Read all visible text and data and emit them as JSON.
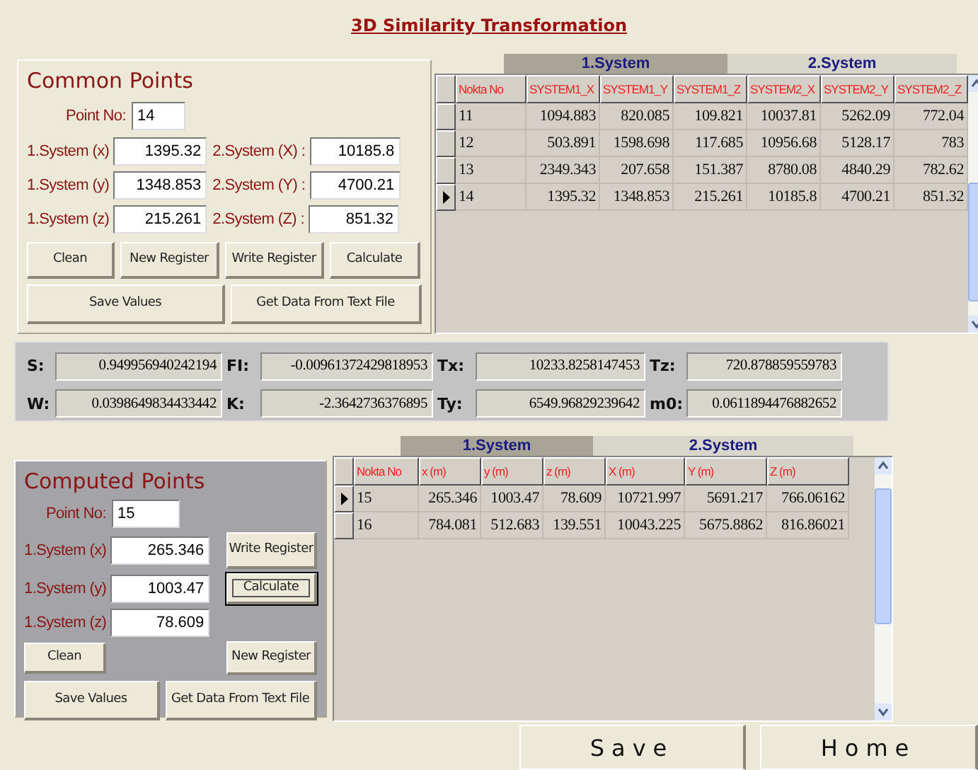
{
  "title": "3D Similarity Transformation",
  "common_points": {
    "heading": "Common Points",
    "point_no": {
      "label": "Point No:",
      "value": "14"
    },
    "fields": [
      {
        "label": "1.System (x)",
        "value": "1395.32"
      },
      {
        "label": "2.System (X) :",
        "value": "10185.8"
      },
      {
        "label": "1.System (y)",
        "value": "1348.853"
      },
      {
        "label": "2.System (Y) :",
        "value": "4700.21"
      },
      {
        "label": "1.System (z)",
        "value": "215.261"
      },
      {
        "label": "2.System (Z) :",
        "value": "851.32"
      }
    ],
    "buttons": [
      {
        "label": "Clean",
        "focused": false
      },
      {
        "label": "New Register",
        "focused": false
      },
      {
        "label": "Write Register",
        "focused": false
      },
      {
        "label": "Calculate",
        "focused": false
      },
      {
        "label": "Save Values",
        "focused": false
      },
      {
        "label": "Get Data From Text File",
        "focused": false
      }
    ]
  },
  "common_grid": {
    "groups": [
      {
        "label": "1.System",
        "selected": true
      },
      {
        "label": "2.System",
        "selected": false
      }
    ],
    "columns": [
      "Nokta No",
      "SYSTEM1_X",
      "SYSTEM1_Y",
      "SYSTEM1_Z",
      "SYSTEM2_X",
      "SYSTEM2_Y",
      "SYSTEM2_Z"
    ],
    "rows": [
      {
        "selected": false,
        "cells": [
          "11",
          "1094.883",
          "820.085",
          "109.821",
          "10037.81",
          "5262.09",
          "772.04"
        ]
      },
      {
        "selected": false,
        "cells": [
          "12",
          "503.891",
          "1598.698",
          "117.685",
          "10956.68",
          "5128.17",
          "783"
        ]
      },
      {
        "selected": false,
        "cells": [
          "13",
          "2349.343",
          "207.658",
          "151.387",
          "8780.08",
          "4840.29",
          "782.62"
        ]
      },
      {
        "selected": true,
        "cells": [
          "14",
          "1395.32",
          "1348.853",
          "215.261",
          "10185.8",
          "4700.21",
          "851.32"
        ]
      }
    ]
  },
  "results": [
    {
      "label": "S:",
      "value": "0.949956940242194"
    },
    {
      "label": "FI:",
      "value": "-0.00961372429818953"
    },
    {
      "label": "Tx:",
      "value": "10233.8258147453"
    },
    {
      "label": "Tz:",
      "value": "720.878859559783"
    },
    {
      "label": "W:",
      "value": "0.0398649834433442"
    },
    {
      "label": "K:",
      "value": "-2.3642736376895"
    },
    {
      "label": "Ty:",
      "value": "6549.96829239642"
    },
    {
      "label": "m0:",
      "value": "0.0611894476882652"
    }
  ],
  "computed_points": {
    "heading": "Computed Points",
    "point_no": {
      "label": "Point No:",
      "value": "15"
    },
    "fields": [
      {
        "label": "1.System (x)",
        "value": "265.346"
      },
      {
        "label": "1.System (y)",
        "value": "1003.47"
      },
      {
        "label": "1.System (z)",
        "value": "78.609"
      }
    ],
    "buttons": [
      {
        "label": "Write Register",
        "focused": false
      },
      {
        "label": "Calculate",
        "focused": true
      },
      {
        "label": "Clean",
        "focused": false
      },
      {
        "label": "New Register",
        "focused": false
      },
      {
        "label": "Save Values",
        "focused": false
      },
      {
        "label": "Get Data From Text File",
        "focused": false
      }
    ]
  },
  "computed_grid": {
    "groups": [
      {
        "label": "1.System",
        "selected": true
      },
      {
        "label": "2.System",
        "selected": false
      }
    ],
    "columns": [
      "Nokta No",
      "x (m)",
      "y (m)",
      "z (m)",
      "X (m)",
      "Y (m)",
      "Z (m)"
    ],
    "rows": [
      {
        "selected": true,
        "cells": [
          "15",
          "265.346",
          "1003.47",
          "78.609",
          "10721.997",
          "5691.217",
          "766.06162"
        ]
      },
      {
        "selected": false,
        "cells": [
          "16",
          "784.081",
          "512.683",
          "139.551",
          "10043.225",
          "5675.8862",
          "816.86021"
        ]
      }
    ]
  },
  "footer_buttons": [
    "Save",
    "Home"
  ]
}
